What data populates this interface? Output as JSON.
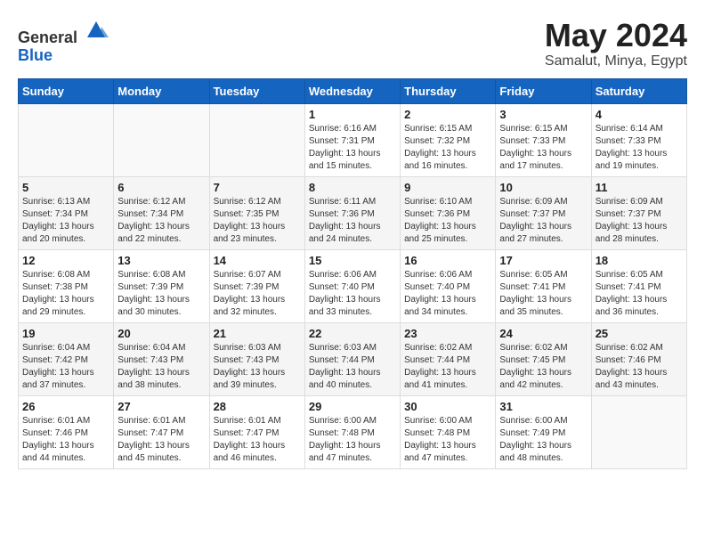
{
  "header": {
    "logo_general": "General",
    "logo_blue": "Blue",
    "month_year": "May 2024",
    "location": "Samalut, Minya, Egypt"
  },
  "days_of_week": [
    "Sunday",
    "Monday",
    "Tuesday",
    "Wednesday",
    "Thursday",
    "Friday",
    "Saturday"
  ],
  "weeks": [
    [
      {
        "day": "",
        "info": ""
      },
      {
        "day": "",
        "info": ""
      },
      {
        "day": "",
        "info": ""
      },
      {
        "day": "1",
        "info": "Sunrise: 6:16 AM\nSunset: 7:31 PM\nDaylight: 13 hours and 15 minutes."
      },
      {
        "day": "2",
        "info": "Sunrise: 6:15 AM\nSunset: 7:32 PM\nDaylight: 13 hours and 16 minutes."
      },
      {
        "day": "3",
        "info": "Sunrise: 6:15 AM\nSunset: 7:33 PM\nDaylight: 13 hours and 17 minutes."
      },
      {
        "day": "4",
        "info": "Sunrise: 6:14 AM\nSunset: 7:33 PM\nDaylight: 13 hours and 19 minutes."
      }
    ],
    [
      {
        "day": "5",
        "info": "Sunrise: 6:13 AM\nSunset: 7:34 PM\nDaylight: 13 hours and 20 minutes."
      },
      {
        "day": "6",
        "info": "Sunrise: 6:12 AM\nSunset: 7:34 PM\nDaylight: 13 hours and 22 minutes."
      },
      {
        "day": "7",
        "info": "Sunrise: 6:12 AM\nSunset: 7:35 PM\nDaylight: 13 hours and 23 minutes."
      },
      {
        "day": "8",
        "info": "Sunrise: 6:11 AM\nSunset: 7:36 PM\nDaylight: 13 hours and 24 minutes."
      },
      {
        "day": "9",
        "info": "Sunrise: 6:10 AM\nSunset: 7:36 PM\nDaylight: 13 hours and 25 minutes."
      },
      {
        "day": "10",
        "info": "Sunrise: 6:09 AM\nSunset: 7:37 PM\nDaylight: 13 hours and 27 minutes."
      },
      {
        "day": "11",
        "info": "Sunrise: 6:09 AM\nSunset: 7:37 PM\nDaylight: 13 hours and 28 minutes."
      }
    ],
    [
      {
        "day": "12",
        "info": "Sunrise: 6:08 AM\nSunset: 7:38 PM\nDaylight: 13 hours and 29 minutes."
      },
      {
        "day": "13",
        "info": "Sunrise: 6:08 AM\nSunset: 7:39 PM\nDaylight: 13 hours and 30 minutes."
      },
      {
        "day": "14",
        "info": "Sunrise: 6:07 AM\nSunset: 7:39 PM\nDaylight: 13 hours and 32 minutes."
      },
      {
        "day": "15",
        "info": "Sunrise: 6:06 AM\nSunset: 7:40 PM\nDaylight: 13 hours and 33 minutes."
      },
      {
        "day": "16",
        "info": "Sunrise: 6:06 AM\nSunset: 7:40 PM\nDaylight: 13 hours and 34 minutes."
      },
      {
        "day": "17",
        "info": "Sunrise: 6:05 AM\nSunset: 7:41 PM\nDaylight: 13 hours and 35 minutes."
      },
      {
        "day": "18",
        "info": "Sunrise: 6:05 AM\nSunset: 7:41 PM\nDaylight: 13 hours and 36 minutes."
      }
    ],
    [
      {
        "day": "19",
        "info": "Sunrise: 6:04 AM\nSunset: 7:42 PM\nDaylight: 13 hours and 37 minutes."
      },
      {
        "day": "20",
        "info": "Sunrise: 6:04 AM\nSunset: 7:43 PM\nDaylight: 13 hours and 38 minutes."
      },
      {
        "day": "21",
        "info": "Sunrise: 6:03 AM\nSunset: 7:43 PM\nDaylight: 13 hours and 39 minutes."
      },
      {
        "day": "22",
        "info": "Sunrise: 6:03 AM\nSunset: 7:44 PM\nDaylight: 13 hours and 40 minutes."
      },
      {
        "day": "23",
        "info": "Sunrise: 6:02 AM\nSunset: 7:44 PM\nDaylight: 13 hours and 41 minutes."
      },
      {
        "day": "24",
        "info": "Sunrise: 6:02 AM\nSunset: 7:45 PM\nDaylight: 13 hours and 42 minutes."
      },
      {
        "day": "25",
        "info": "Sunrise: 6:02 AM\nSunset: 7:46 PM\nDaylight: 13 hours and 43 minutes."
      }
    ],
    [
      {
        "day": "26",
        "info": "Sunrise: 6:01 AM\nSunset: 7:46 PM\nDaylight: 13 hours and 44 minutes."
      },
      {
        "day": "27",
        "info": "Sunrise: 6:01 AM\nSunset: 7:47 PM\nDaylight: 13 hours and 45 minutes."
      },
      {
        "day": "28",
        "info": "Sunrise: 6:01 AM\nSunset: 7:47 PM\nDaylight: 13 hours and 46 minutes."
      },
      {
        "day": "29",
        "info": "Sunrise: 6:00 AM\nSunset: 7:48 PM\nDaylight: 13 hours and 47 minutes."
      },
      {
        "day": "30",
        "info": "Sunrise: 6:00 AM\nSunset: 7:48 PM\nDaylight: 13 hours and 47 minutes."
      },
      {
        "day": "31",
        "info": "Sunrise: 6:00 AM\nSunset: 7:49 PM\nDaylight: 13 hours and 48 minutes."
      },
      {
        "day": "",
        "info": ""
      }
    ]
  ]
}
